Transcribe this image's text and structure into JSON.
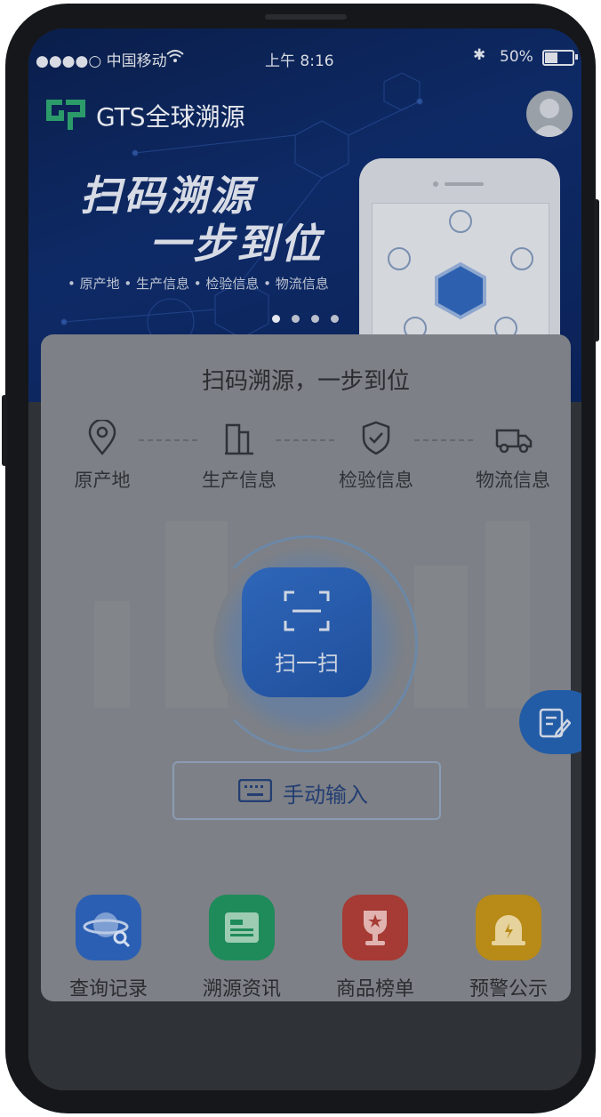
{
  "status_bar": {
    "carrier": "●●●●○ 中国移动 ",
    "wifi_icon": "wifi-icon",
    "time": "上午 8:16",
    "bluetooth": "✱",
    "battery_percent": "50%",
    "battery_level": 0.5
  },
  "header": {
    "app_title": "GTS全球溯源",
    "logo": "gtc-logo"
  },
  "banner": {
    "headline_line1": "扫码溯源",
    "headline_line2": "一步到位",
    "subtitle": "• 原产地 • 生产信息 • 检验信息 • 物流信息",
    "carousel_pages": 4,
    "carousel_active": 0
  },
  "card": {
    "title": "扫码溯源，一步到位",
    "features": [
      {
        "label": "原产地",
        "icon": "location-pin-icon"
      },
      {
        "label": "生产信息",
        "icon": "factory-building-icon"
      },
      {
        "label": "检验信息",
        "icon": "shield-check-icon"
      },
      {
        "label": "物流信息",
        "icon": "truck-icon"
      }
    ],
    "scan_label": "扫一扫",
    "manual_input_label": "手动输入",
    "quick_actions": [
      {
        "label": "查询记录",
        "icon": "planet-search-icon",
        "color": "#2b5fb3"
      },
      {
        "label": "溯源资讯",
        "icon": "news-card-icon",
        "color": "#1f8b5a"
      },
      {
        "label": "商品榜单",
        "icon": "trophy-icon",
        "color": "#a63a34"
      },
      {
        "label": "预警公示",
        "icon": "alarm-bell-icon",
        "color": "#b88a17"
      }
    ]
  },
  "floating_action": {
    "icon": "edit-form-icon"
  },
  "colors": {
    "banner": "#0e2a66",
    "card_overlay": "#7d8086",
    "accent_blue": "#235ca6"
  }
}
